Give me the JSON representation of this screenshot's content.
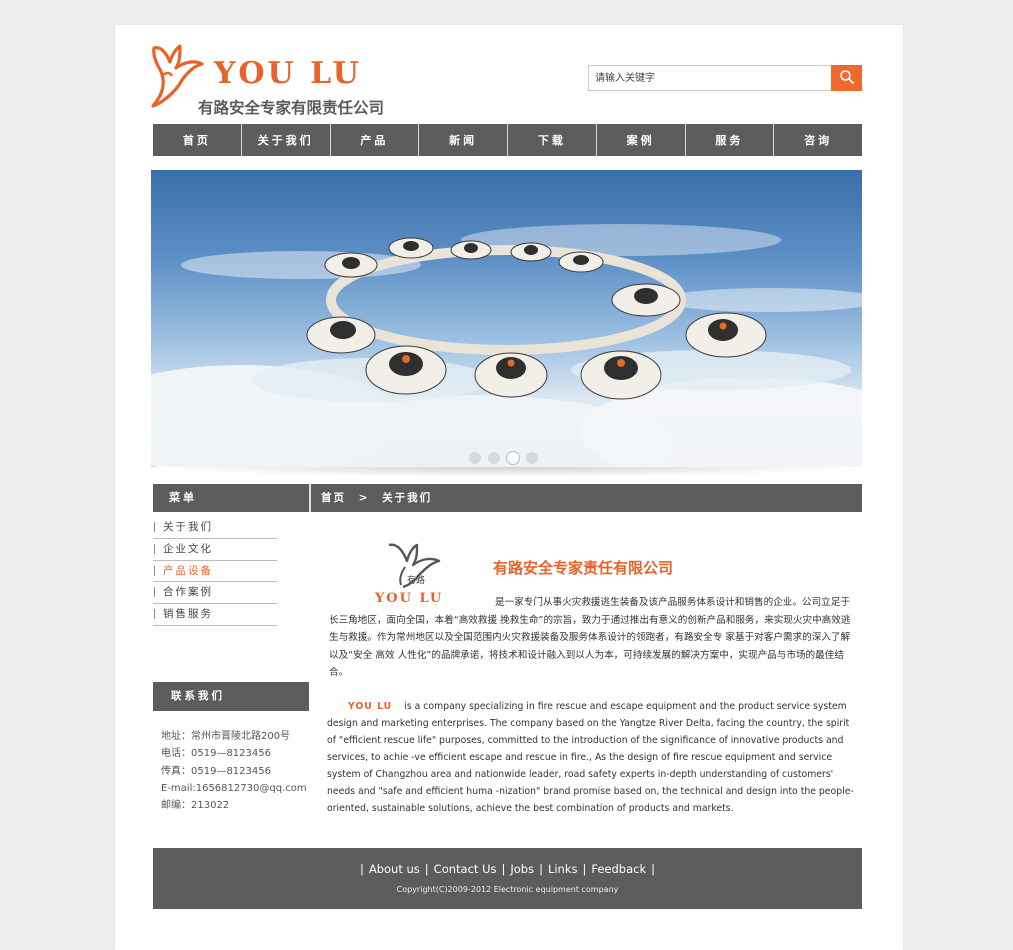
{
  "header": {
    "logo_en": "YOU LU",
    "logo_cn": "有路安全专家有限责任公司",
    "search_placeholder": "请输入关键字"
  },
  "nav": [
    "首页",
    "关于我们",
    "产品",
    "新闻",
    "下载",
    "案例",
    "服务",
    "咨询"
  ],
  "banner": {
    "slide_count": 4,
    "active_slide": 3
  },
  "sidebar": {
    "menu_title": "菜单",
    "menu_items": [
      "关于我们",
      "企业文化",
      "产品设备",
      "合作案例",
      "销售服务"
    ],
    "active_item": "产品设备",
    "contact_title": "联系我们",
    "contact": [
      "地址：常州市晋陵北路200号",
      "电话：0519—8123456",
      "传真：0519—8123456",
      "E-mail:1656812730@qq.com",
      "邮编：213022"
    ]
  },
  "breadcrumb": {
    "home": "首页",
    "separator": ">",
    "current": "关于我们"
  },
  "about": {
    "logo_text": "YOU LU",
    "title": "有路安全专家责任有限公司",
    "cn_text": "是一家专门从事火灾救援逃生装备及该产品服务体系设计和销售的企业。公司立足于长三角地区，面向全国，本着“高效救援 挽救生命”的宗旨，致力于通过推出有意义的创新产品和服务，来实现火灾中高效逃生与救援。作为常州地区以及全国范围内火灾救援装备及服务体系设计的领跑者，有路安全专 家基于对客户需求的深入了解以及“安全 高效 人性化”的品牌承诺，将技术和设计融入到以人为本，可持续发展的解决方案中，实现产品与市场的最佳结合。",
    "en_brand": "YOU LU",
    "en_text": "is a company specializing in fire rescue and escape equipment and the product service system design and marketing enterprises. The company based on the Yangtze River Delta, facing the country, the spirit of \"efficient rescue life\" purposes, committed to the introduction of the significance of innovative products and services, to achie -ve efficient escape and rescue in fire., As the design of fire rescue equipment and service system of Changzhou area and nationwide leader, road safety experts in-depth understanding of customers' needs and \"safe and efficient huma -nization\" brand promise based on, the technical and design into the people-oriented, sustainable solutions, achieve the best combination of products and markets."
  },
  "footer": {
    "links": [
      "About us",
      "Contact Us",
      "Jobs",
      "Links",
      "Feedback"
    ],
    "copyright": "Copyright(C)2009-2012 Electronic equipment company"
  },
  "colors": {
    "accent": "#e8622a",
    "bar": "#5c5c5c",
    "page": "#ffffff",
    "background": "#eeeeec"
  },
  "icons": {
    "search": "magnifier-icon",
    "logo": "bird-icon"
  }
}
